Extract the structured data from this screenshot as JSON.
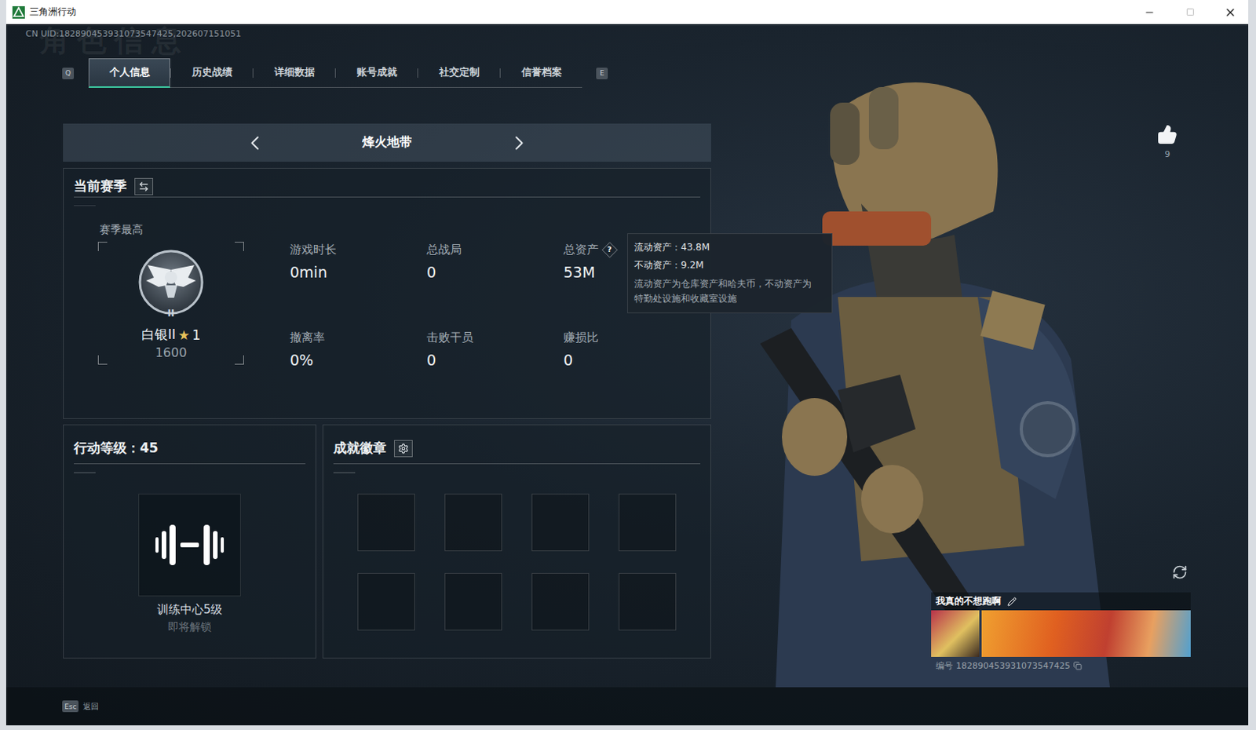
{
  "window": {
    "title": "三角洲行动"
  },
  "uid": "CN UID:182890453931073547425,202607151051",
  "watermark": "角色信息",
  "tab_keys": {
    "prev": "Q",
    "next": "E"
  },
  "tabs": [
    {
      "label": "个人信息",
      "selected": true
    },
    {
      "label": "历史战绩",
      "selected": false
    },
    {
      "label": "详细数据",
      "selected": false
    },
    {
      "label": "账号成就",
      "selected": false
    },
    {
      "label": "社交定制",
      "selected": false
    },
    {
      "label": "信誉档案",
      "selected": false
    }
  ],
  "mode": {
    "label": "烽火地带"
  },
  "season": {
    "title": "当前赛季",
    "best_label": "赛季最高",
    "badge_numeral": "II",
    "rank": "白银II",
    "star": "★",
    "star_count": "1",
    "score": "1600",
    "stats": [
      {
        "label": "游戏时长",
        "value": "0min"
      },
      {
        "label": "总战局",
        "value": "0"
      },
      {
        "label": "总资产",
        "value": "53M",
        "help": "?",
        "tooltip": {
          "lines": [
            {
              "label": "流动资产：",
              "value": "43.8M"
            },
            {
              "label": "不动资产：",
              "value": "9.2M"
            }
          ],
          "note": "流动资产为仓库资产和哈夫币，不动资产为特勤处设施和收藏室设施"
        }
      },
      {
        "label": "撤离率",
        "value": "0%"
      },
      {
        "label": "击败干员",
        "value": "0"
      },
      {
        "label": "赚损比",
        "value": "0"
      }
    ]
  },
  "action_level": {
    "label": "行动等级：",
    "value": "45",
    "unlock": "训练中心5级",
    "status": "即将解锁"
  },
  "badges": {
    "title": "成就徽章",
    "slots": [
      {
        "filled": false
      },
      {
        "filled": false
      },
      {
        "filled": false
      },
      {
        "filled": false
      },
      {
        "filled": false
      },
      {
        "filled": false
      },
      {
        "filled": false
      },
      {
        "filled": false
      }
    ]
  },
  "likes": {
    "count": "9"
  },
  "card": {
    "name": "我真的不想跑啊",
    "id_label": "编号",
    "id": "182890453931073547425"
  },
  "footer": {
    "key": "Esc",
    "label": "返回"
  }
}
